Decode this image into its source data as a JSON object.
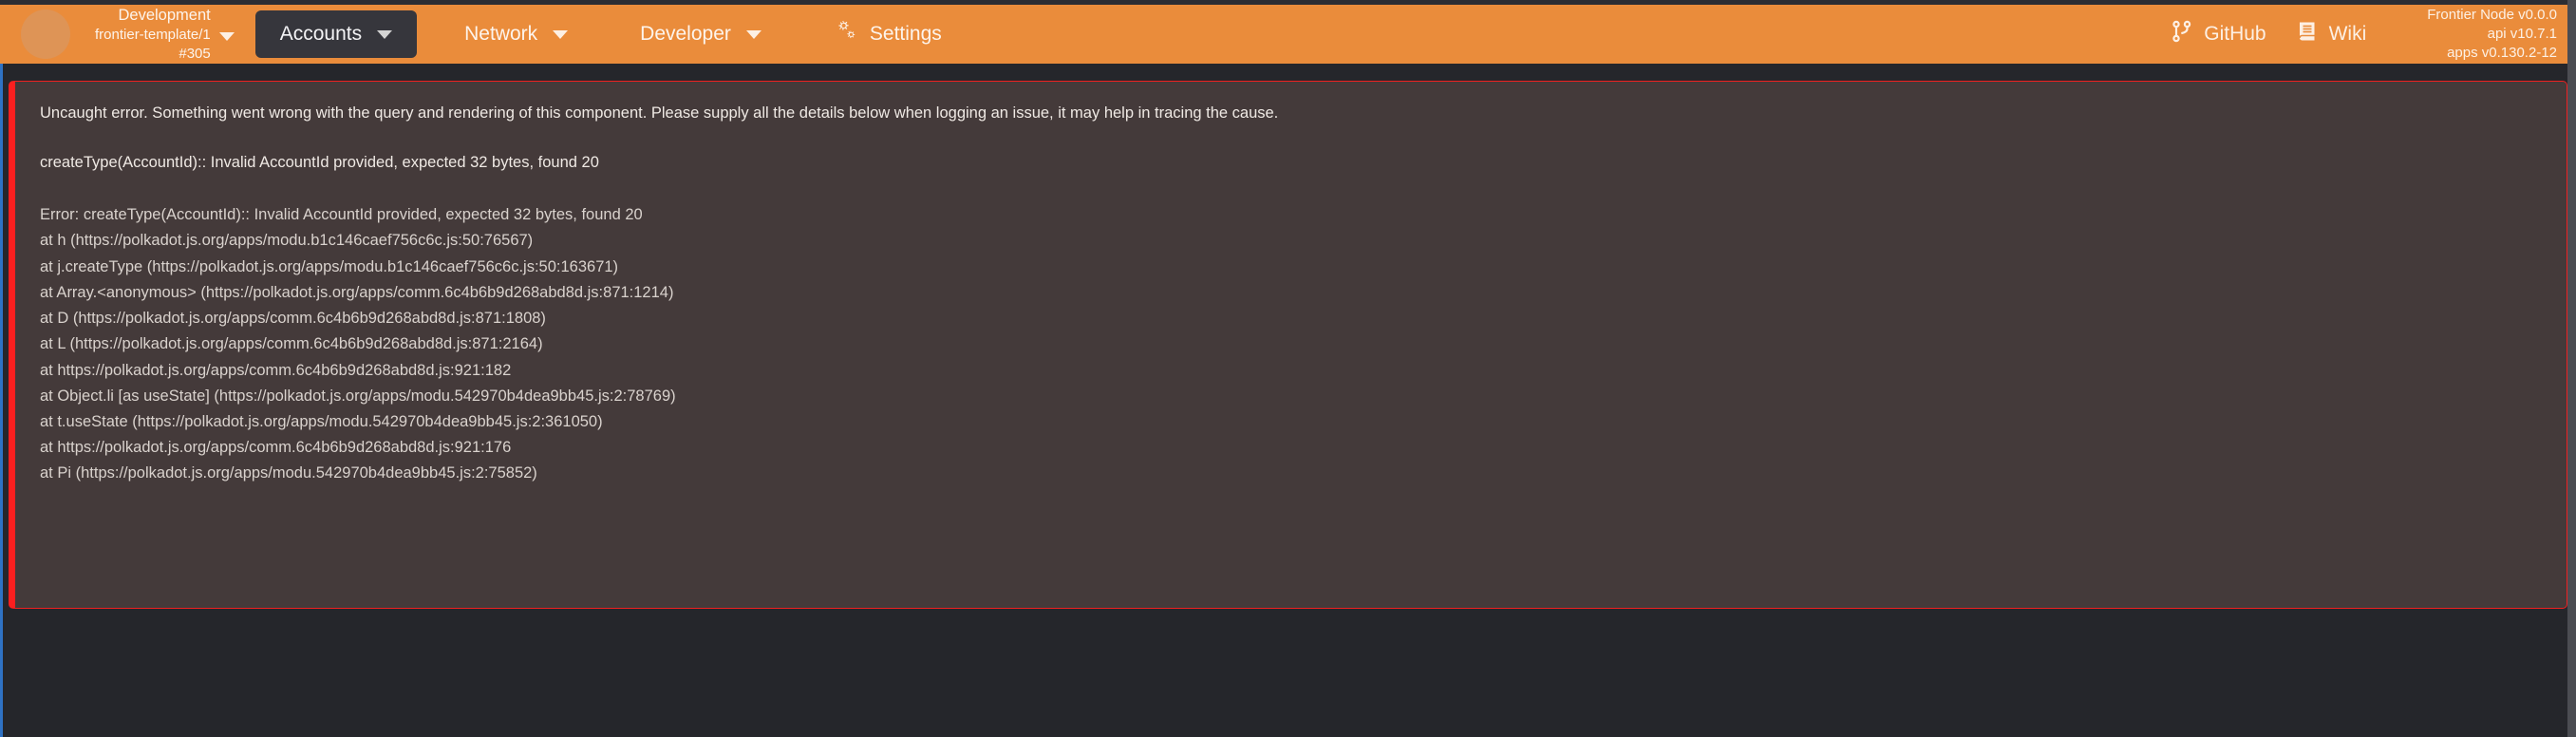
{
  "theme": {
    "header_bg": "#ea8c3b",
    "page_bg": "#25262b",
    "error_bg": "#443a3a",
    "error_border": "#ef2020",
    "active_tab_bg": "#36363c",
    "text_light": "#fdf4ec"
  },
  "header": {
    "avatar": "node-avatar",
    "chain": {
      "name": "Development",
      "spec": "frontier-template/1",
      "block": "#305",
      "caret_icon": "chevron-down-icon"
    },
    "nav": [
      {
        "label": "Accounts",
        "name": "accounts",
        "active": true,
        "has_caret": true,
        "icon": null
      },
      {
        "label": "Network",
        "name": "network",
        "active": false,
        "has_caret": true,
        "icon": null
      },
      {
        "label": "Developer",
        "name": "developer",
        "active": false,
        "has_caret": true,
        "icon": null
      },
      {
        "label": "Settings",
        "name": "settings",
        "active": false,
        "has_caret": false,
        "icon": "gears-icon"
      }
    ],
    "links": [
      {
        "label": "GitHub",
        "name": "github",
        "icon": "code-branch-icon"
      },
      {
        "label": "Wiki",
        "name": "wiki",
        "icon": "book-icon"
      }
    ],
    "versions": {
      "node": "Frontier Node v0.0.0",
      "api": "api v10.7.1",
      "apps": "apps v0.130.2-12"
    }
  },
  "error": {
    "summary": "Uncaught error. Something went wrong with the query and rendering of this component. Please supply all the details below when logging an issue, it may help in tracing the cause.",
    "message": "createType(AccountId):: Invalid AccountId provided, expected 32 bytes, found 20",
    "stack": [
      "Error: createType(AccountId):: Invalid AccountId provided, expected 32 bytes, found 20",
      "at h (https://polkadot.js.org/apps/modu.b1c146caef756c6c.js:50:76567)",
      "at j.createType (https://polkadot.js.org/apps/modu.b1c146caef756c6c.js:50:163671)",
      "at Array.<anonymous> (https://polkadot.js.org/apps/comm.6c4b6b9d268abd8d.js:871:1214)",
      "at D (https://polkadot.js.org/apps/comm.6c4b6b9d268abd8d.js:871:1808)",
      "at L (https://polkadot.js.org/apps/comm.6c4b6b9d268abd8d.js:871:2164)",
      "at https://polkadot.js.org/apps/comm.6c4b6b9d268abd8d.js:921:182",
      "at Object.li [as useState] (https://polkadot.js.org/apps/modu.542970b4dea9bb45.js:2:78769)",
      "at t.useState (https://polkadot.js.org/apps/modu.542970b4dea9bb45.js:2:361050)",
      "at https://polkadot.js.org/apps/comm.6c4b6b9d268abd8d.js:921:176",
      "at Pi (https://polkadot.js.org/apps/modu.542970b4dea9bb45.js:2:75852)"
    ]
  }
}
